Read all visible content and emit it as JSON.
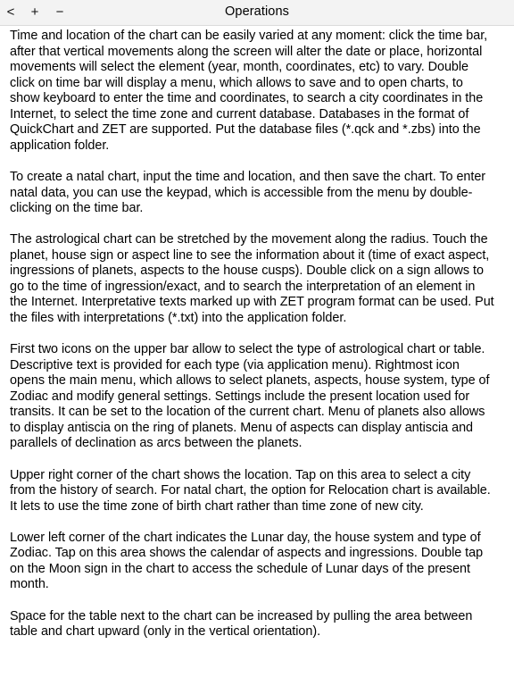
{
  "nav": {
    "back_label": "<",
    "plus_label": "+",
    "minus_label": "−",
    "title": "Operations"
  },
  "paragraphs": [
    [
      "Time and location of the chart can be easily varied at any moment: click the time bar,",
      "after that vertical movements along the screen will alter the date or place, horizontal",
      "movements will select the element (year, month, coordinates, etc) to vary. Double",
      "click on time bar will display a menu, which allows to save and to open charts, to",
      "show keyboard to enter the time and coordinates, to search a city coordinates in the",
      "Internet, to select the time zone and current database. Databases in the format of",
      "QuickChart and ZET are supported.  Put the database files (*.qck and *.zbs) into the",
      "application folder."
    ],
    [
      "To create a natal chart, input the time and location, and then save the chart. To enter",
      "natal data, you can use the keypad, which is accessible from the menu by double-",
      "clicking on the time bar."
    ],
    [
      "The astrological chart can be stretched by the movement along the radius. Touch the",
      "planet, house sign or aspect line to see the information about it (time of exact aspect,",
      "ingressions of planets,  aspects to the house cusps). Double click on a sign allows to",
      "go to the time of ingression/exact, and to search the interpretation of an element in",
      "the Internet. Interpretative texts marked up with ZET program format can be used. Put",
      "the files with interpretations (*.txt) into the application folder."
    ],
    [
      "First two icons on the upper bar allow to select the type of astrological chart or table.",
      "Descriptive text is provided for each type (via application menu). Rightmost icon",
      "opens the main menu, which allows to select planets, aspects, house system, type of",
      "Zodiac and modify general settings. Settings include the present location used for",
      "transits. It can be set to the location of the current chart. Menu of planets also allows",
      "to display antiscia on the ring of planets. Menu of aspects can display antiscia and",
      "parallels of declination as arcs between the planets."
    ],
    [
      "Upper right corner of the chart shows the location. Tap on this area to select a city",
      "from the history of search. For natal chart, the option for Relocation chart is available.",
      "It lets to use the time zone of birth chart rather than time zone of new city."
    ],
    [
      "Lower left corner of the chart indicates the Lunar day, the house system and type of",
      "Zodiac. Tap on this area shows the calendar of aspects and ingressions. Double tap",
      "on the Moon sign in the chart to access the schedule of Lunar days of the present",
      "month."
    ],
    [
      "Space for the table next to the chart can be increased by pulling the area between",
      "table and chart upward (only in the vertical orientation)."
    ]
  ]
}
